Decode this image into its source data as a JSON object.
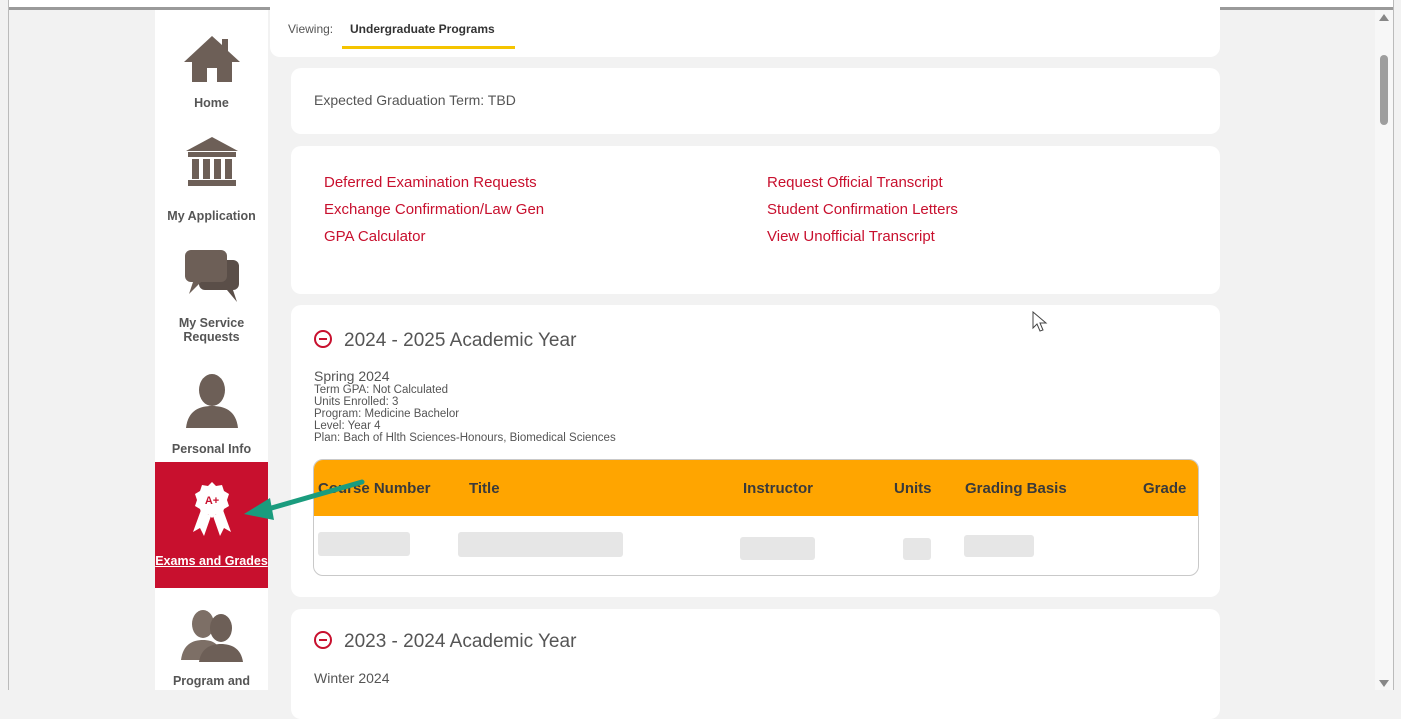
{
  "sidebar": {
    "items": [
      {
        "label": "Home",
        "icon": "home-icon"
      },
      {
        "label": "My Application",
        "icon": "bank-icon"
      },
      {
        "label": "My Service Requests",
        "icon": "chat-bubbles-icon"
      },
      {
        "label": "Personal Info",
        "icon": "person-icon"
      },
      {
        "label": "Exams and Grades",
        "icon": "award-ribbon-icon",
        "badge": "A+",
        "active": true
      },
      {
        "label": "Program and",
        "icon": "people-icon"
      }
    ]
  },
  "viewing": {
    "label": "Viewing:",
    "value": "Undergraduate Programs"
  },
  "graduation": {
    "text": "Expected Graduation Term: TBD"
  },
  "links": {
    "left": [
      "Deferred Examination Requests",
      "Exchange Confirmation/Law Gen",
      "GPA Calculator"
    ],
    "right": [
      "Request Official Transcript",
      "Student Confirmation Letters",
      "View Unofficial Transcript"
    ]
  },
  "years": [
    {
      "title": "2024 - 2025 Academic Year",
      "term": {
        "name": "Spring 2024",
        "gpa": "Term GPA: Not Calculated",
        "units": "Units Enrolled: 3",
        "program": "Program: Medicine Bachelor",
        "level": "Level: Year 4",
        "plan": "Plan: Bach of Hlth Sciences-Honours, Biomedical Sciences"
      },
      "table": {
        "headers": [
          "Course Number",
          "Title",
          "Instructor",
          "Units",
          "Grading Basis",
          "Grade"
        ]
      }
    },
    {
      "title": "2023 - 2024 Academic Year",
      "term": {
        "name": "Winter 2024"
      }
    }
  ],
  "colors": {
    "accent": "#c8102e",
    "table_header": "#ffa500",
    "tab_underline": "#f5c400",
    "annotation_arrow": "#1a9c7e"
  }
}
